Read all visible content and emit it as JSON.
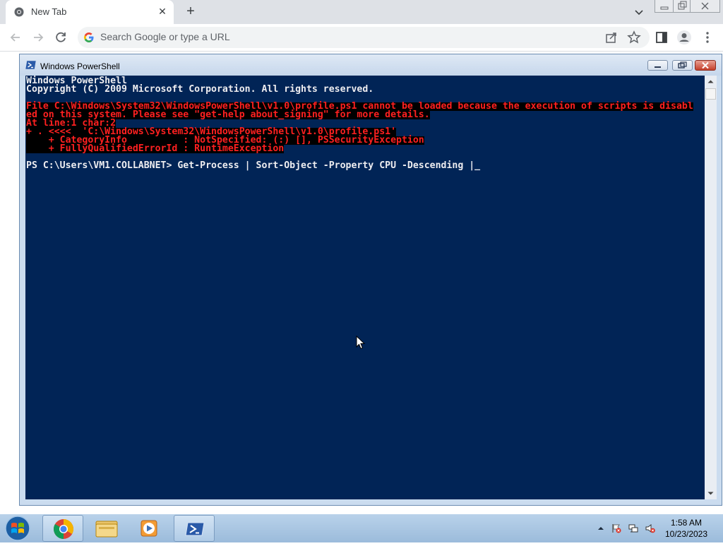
{
  "browser": {
    "tab_title": "New Tab",
    "tab_close": "✕",
    "new_tab": "+",
    "omnibox_placeholder": "Search Google or type a URL"
  },
  "powershell": {
    "window_title": "Windows PowerShell",
    "lines": [
      {
        "text": "Windows PowerShell",
        "style": "white"
      },
      {
        "text": "Copyright (C) 2009 Microsoft Corporation. All rights reserved.",
        "style": "white"
      },
      {
        "text": "",
        "style": "white"
      },
      {
        "text": "File C:\\Windows\\System32\\WindowsPowerShell\\v1.0\\profile.ps1 cannot be loaded because the execution of scripts is disabl",
        "style": "err"
      },
      {
        "text": "ed on this system. Please see \"get-help about_signing\" for more details.",
        "style": "err"
      },
      {
        "text": "At line:1 char:2",
        "style": "err"
      },
      {
        "text": "+ . <<<<  'C:\\Windows\\System32\\WindowsPowerShell\\v1.0\\profile.ps1'",
        "style": "err"
      },
      {
        "text": "    + CategoryInfo          : NotSpecified: (:) [], PSSecurityException",
        "style": "err"
      },
      {
        "text": "    + FullyQualifiedErrorId : RuntimeException",
        "style": "err"
      },
      {
        "text": "",
        "style": "white"
      },
      {
        "text": "PS C:\\Users\\VM1.COLLABNET> Get-Process | Sort-Object -Property CPU -Descending |_",
        "style": "white"
      }
    ]
  },
  "taskbar": {
    "items": [
      "start-orb",
      "chrome",
      "file-explorer",
      "media-player",
      "powershell"
    ],
    "clock_time": "1:58 AM",
    "clock_date": "10/23/2023"
  }
}
